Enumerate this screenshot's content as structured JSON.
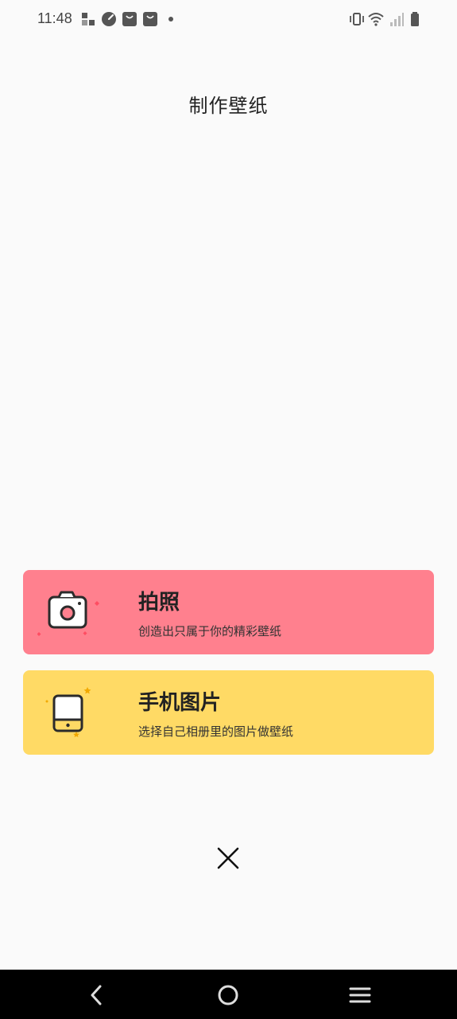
{
  "status_bar": {
    "time": "11:48",
    "left_icons": [
      "shuffle-app-icon",
      "speedometer-icon",
      "bag-icon",
      "bag-icon",
      "dot-icon"
    ],
    "right_icons": [
      "vibrate-icon",
      "wifi-icon",
      "signal-icon",
      "battery-icon"
    ]
  },
  "page": {
    "title": "制作壁纸"
  },
  "options": {
    "photo": {
      "title": "拍照",
      "subtitle": "创造出只属于你的精彩壁纸",
      "color": "#ff808e",
      "icon": "camera-icon"
    },
    "album": {
      "title": "手机图片",
      "subtitle": "选择自己相册里的图片做壁纸",
      "color": "#ffda65",
      "icon": "phone-gallery-icon"
    }
  },
  "close": {
    "icon": "close-icon"
  },
  "nav_bar": {
    "icons": [
      "back-icon",
      "home-icon",
      "menu-icon"
    ]
  }
}
